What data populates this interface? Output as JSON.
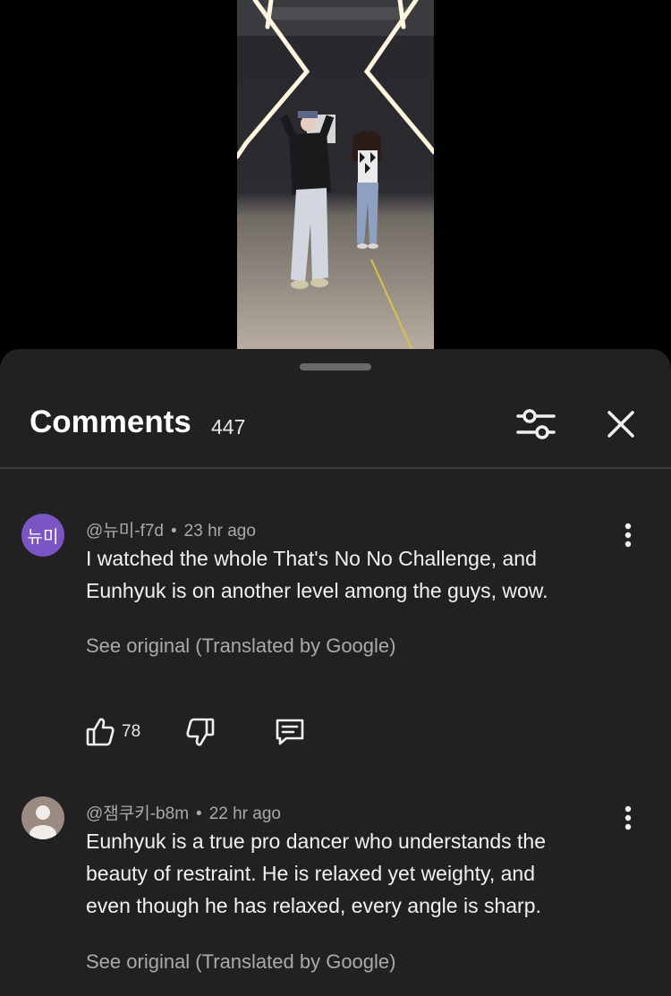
{
  "header": {
    "title": "Comments",
    "count": "447"
  },
  "icons": {
    "filter": "sliders-icon",
    "close": "close-icon",
    "more": "more-vertical-icon",
    "like": "thumbs-up-icon",
    "dislike": "thumbs-down-icon",
    "reply": "reply-icon"
  },
  "comments": [
    {
      "author": "@뉴미-f7d",
      "time": "23 hr ago",
      "avatar_text": "뉴미",
      "lines": [
        "I watched the whole That's No No Challenge, and",
        "Eunhyuk is on another level among the guys, wow."
      ],
      "see_original": "See original (Translated by Google)",
      "likes": "78"
    },
    {
      "author": "@잼쿠키-b8m",
      "time": "22 hr ago",
      "lines": [
        "Eunhyuk is a true pro dancer who understands the",
        "beauty of restraint. He is relaxed yet weighty, and",
        "even though he has relaxed, every angle is sharp."
      ],
      "see_original": "See original (Translated by Google)"
    }
  ],
  "colors": {
    "sheet_bg": "#212121",
    "avatar_purple": "#7b55c4",
    "secondary_text": "#aaaaaa"
  }
}
